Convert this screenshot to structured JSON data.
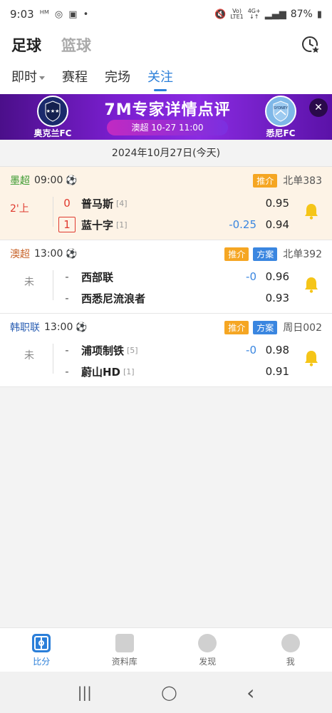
{
  "status_bar": {
    "time": "9:03",
    "carrier": "ᴴᴹ",
    "battery": "87%",
    "net_top": "Vo)",
    "net_bottom": "LTE1",
    "signal_4g": "4G+"
  },
  "sports_tabs": [
    {
      "label": "足球",
      "active": true
    },
    {
      "label": "篮球",
      "active": false
    }
  ],
  "sub_tabs": [
    {
      "label": "即时",
      "has_caret": true
    },
    {
      "label": "赛程"
    },
    {
      "label": "完场"
    },
    {
      "label": "关注",
      "active": true
    }
  ],
  "banner": {
    "title": "7M专家详情点评",
    "pill": "澳超  10-27 11:00",
    "home_team": "奥克兰FC",
    "away_team": "悉尼FC",
    "close_label": "✕",
    "colors": {
      "bg": "#7a1ecf",
      "pill": "#c12ac2"
    }
  },
  "date_label": "2024年10月27日(今天)",
  "matches": [
    {
      "league": "墨超",
      "league_color": "#3a9a2f",
      "time": "09:00",
      "ball": "⚽",
      "tags": [
        {
          "label": "推介",
          "color": "orange"
        }
      ],
      "code": "北单383",
      "status": "2'上",
      "status_color": "#e03a2f",
      "home": {
        "score": "0",
        "name": "普马斯",
        "rank": "[4]"
      },
      "away": {
        "score": "1",
        "name": "蓝十字",
        "rank": "[1]"
      },
      "handicap_home": "",
      "handicap_away": "-0.25",
      "odds_home": "0.95",
      "odds_away": "0.94"
    },
    {
      "league": "澳超",
      "league_color": "#c8642a",
      "time": "13:00",
      "ball": "⚽",
      "tags": [
        {
          "label": "推介",
          "color": "orange"
        },
        {
          "label": "方案",
          "color": "blue"
        }
      ],
      "code": "北单392",
      "status": "未",
      "status_color": "#888",
      "home": {
        "score": "-",
        "name": "西部联",
        "rank": ""
      },
      "away": {
        "score": "-",
        "name": "西悉尼流浪者",
        "rank": ""
      },
      "handicap_home": "-0",
      "handicap_away": "",
      "odds_home": "0.96",
      "odds_away": "0.93"
    },
    {
      "league": "韩职联",
      "league_color": "#2b5fb3",
      "time": "13:00",
      "ball": "⚽",
      "tags": [
        {
          "label": "推介",
          "color": "orange"
        },
        {
          "label": "方案",
          "color": "blue"
        }
      ],
      "code": "周日002",
      "status": "未",
      "status_color": "#888",
      "home": {
        "score": "-",
        "name": "浦项制铁",
        "rank": "[5]"
      },
      "away": {
        "score": "-",
        "name": "蔚山HD",
        "rank": "[1]"
      },
      "handicap_home": "-0",
      "handicap_away": "",
      "odds_home": "0.98",
      "odds_away": "0.91"
    }
  ],
  "bottom_nav": [
    {
      "label": "比分",
      "icon": "scoreboard-icon",
      "active": true
    },
    {
      "label": "资料库",
      "icon": "folder-icon",
      "active": false
    },
    {
      "label": "发现",
      "icon": "discover-icon",
      "active": false
    },
    {
      "label": "我",
      "icon": "profile-icon",
      "active": false
    }
  ],
  "system_nav": {
    "recent": "|||",
    "home": "◯",
    "back": "‹"
  },
  "accent_color": "#2b7fd9"
}
